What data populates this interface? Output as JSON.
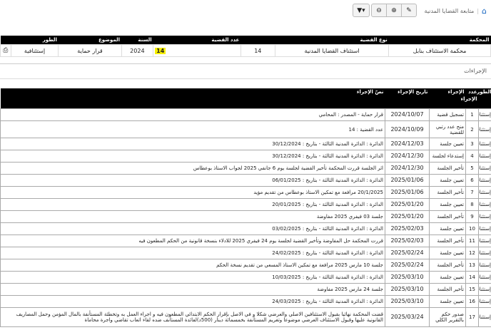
{
  "breadcrumb": {
    "label": "متابعة القضايا المدنية"
  },
  "case_table": {
    "headers": {
      "court": "المحكمة",
      "case_type": "نوع القضية",
      "case_no": "عدد القضية",
      "year": "السنة",
      "subject": "الموضوع",
      "stage": "الطور"
    },
    "row": {
      "court": "محكمة الاستئناف بنابل",
      "case_type": "استئناف القضايا المدنية",
      "case_no_left": "14",
      "case_no_right": "14",
      "year": "2024",
      "subject": "قرار حماية",
      "stage": "إستئنافية"
    }
  },
  "tabs": {
    "procedures": "الإجراءات"
  },
  "procedures": {
    "headers": {
      "stage": "الطور",
      "proc_no": "عدد الإجراء",
      "proc": "الإجراء",
      "date": "تاريخ الإجراء",
      "text": "نصّ الإجراء"
    },
    "rows": [
      {
        "stage": "إستئنافية",
        "no": "1",
        "proc": "تسجيل قضية",
        "date": "2024/10/07",
        "text": "قرار حماية - المصدر : المحامي"
      },
      {
        "stage": "إستئنافية",
        "no": "2",
        "proc": "منح عدد رتبي للقضية",
        "date": "2024/10/09",
        "text": "عدد القضية : 14"
      },
      {
        "stage": "إستئنافية",
        "no": "3",
        "proc": "تعيين جلسة",
        "date": "2024/12/03",
        "text": "الدائرة : الدائرة المدنية الثالثة - بتاريخ : 30/12/2024"
      },
      {
        "stage": "إستئنافية",
        "no": "4",
        "proc": "إستدعاء لجلسة",
        "date": "2024/12/30",
        "text": "الدائرة : الدائرة المدنية الثالثة - بتاريخ : 30/12/2024"
      },
      {
        "stage": "إستئنافية",
        "no": "5",
        "proc": "تأخير الجلسة",
        "date": "2024/12/30",
        "text": "اثر الجلسة قررت المحكمة تأخير القضية لجلسة يوم 6 جانفي 2025 لجواب الاستاذ بوعطاس"
      },
      {
        "stage": "إستئنافية",
        "no": "6",
        "proc": "تعيين جلسة",
        "date": "2025/01/06",
        "text": "الدائرة : الدائرة المدنية الثالثة - بتاريخ : 06/01/2025"
      },
      {
        "stage": "إستئنافية",
        "no": "7",
        "proc": "تأخير الجلسة",
        "date": "2025/01/06",
        "text": "20/1/2025 مرافعة مع تمكين الاستاذ بوعطاس من تقديم مؤيد"
      },
      {
        "stage": "إستئنافية",
        "no": "8",
        "proc": "تعيين جلسة",
        "date": "2025/01/20",
        "text": "الدائرة : الدائرة المدنية الثالثة - بتاريخ : 20/01/2025"
      },
      {
        "stage": "إستئنافية",
        "no": "9",
        "proc": "تأخير الجلسة",
        "date": "2025/01/20",
        "text": "جلسة 03 فيفري 2025 مفاوضة"
      },
      {
        "stage": "إستئنافية",
        "no": "10",
        "proc": "تعيين جلسة",
        "date": "2025/02/03",
        "text": "الدائرة : الدائرة المدنية الثالثة - بتاريخ : 03/02/2025"
      },
      {
        "stage": "إستئنافية",
        "no": "11",
        "proc": "تأخير الجلسة",
        "date": "2025/02/03",
        "text": "قررت المحكمة حل المفاوضة وتأخير القضية لجلسة يوم 24 فيفري 2025 للادلاء بنسخة قانونية من الحكم المطعون فيه"
      },
      {
        "stage": "إستئنافية",
        "no": "12",
        "proc": "تعيين جلسة",
        "date": "2025/02/24",
        "text": "الدائرة : الدائرة المدنية الثالثة - بتاريخ : 24/02/2025"
      },
      {
        "stage": "إستئنافية",
        "no": "13",
        "proc": "تأخير الجلسة",
        "date": "2025/02/24",
        "text": "جلسة 10 مارس 2025 مرافعة مع تمكين الاستاذ المسعي من تقديم نسخة الحكم"
      },
      {
        "stage": "إستئنافية",
        "no": "14",
        "proc": "تعيين جلسة",
        "date": "2025/03/10",
        "text": "الدائرة : الدائرة المدنية الثالثة - بتاريخ : 10/03/2025"
      },
      {
        "stage": "إستئنافية",
        "no": "15",
        "proc": "تأخير الجلسة",
        "date": "2025/03/10",
        "text": "جلسة 24 مارس 2025 مفاوضة"
      },
      {
        "stage": "إستئنافية",
        "no": "16",
        "proc": "تعيين جلسة",
        "date": "2025/03/10",
        "text": "الدائرة : الدائرة المدنية الثالثة - بتاريخ : 24/03/2025"
      },
      {
        "stage": "إستئنافية",
        "no": "17",
        "proc": "صدور حكم بالتقرير الكلي",
        "date": "2025/03/24",
        "text": "قضت المحكمة نهائيا بقبول الاستئنافين الاصلي والعرضي شكلا و في الاصل بإقرار الحكم الابتدائي المطعون فيه و اجراء العمل به وتخطئة المستأنفة بالمال المؤمن وحمل المصاريف القانونية عليها وقبول الاستئناف العرضي موضوعا وتغريم المستأنفة بخمسمائة دينار (500د)لفائدة المستأنف ضده لقاء اتعاب تقاضي واجرة محاماة"
      }
    ]
  }
}
